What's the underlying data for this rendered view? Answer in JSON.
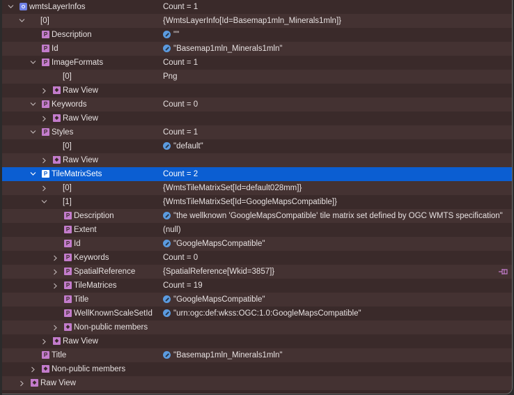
{
  "colors": {
    "selection": "#0b5ed2",
    "property_icon": "#c37ccc",
    "object_icon": "#6f80e6",
    "edit_icon": "#5b9be0"
  },
  "rows": [
    {
      "level": 0,
      "expander": "expanded",
      "icon": "object-icon",
      "name": "wmtsLayerInfos",
      "value": "Count = 1"
    },
    {
      "level": 1,
      "expander": "expanded",
      "icon": "",
      "name": "[0]",
      "value": "{WmtsLayerInfo[Id=Basemap1mln_Minerals1mln]}"
    },
    {
      "level": 2,
      "expander": "",
      "icon": "property-icon",
      "name": "Description",
      "value": "\"\"",
      "editable": true
    },
    {
      "level": 2,
      "expander": "",
      "icon": "property-icon",
      "name": "Id",
      "value": "\"Basemap1mln_Minerals1mln\"",
      "editable": true
    },
    {
      "level": 2,
      "expander": "expanded",
      "icon": "property-icon",
      "name": "ImageFormats",
      "value": "Count = 1"
    },
    {
      "level": 3,
      "expander": "",
      "icon": "",
      "name": "[0]",
      "value": "Png"
    },
    {
      "level": 3,
      "expander": "collapsed",
      "icon": "folder-icon",
      "name": "Raw View",
      "value": ""
    },
    {
      "level": 2,
      "expander": "expanded",
      "icon": "property-icon",
      "name": "Keywords",
      "value": "Count = 0"
    },
    {
      "level": 3,
      "expander": "collapsed",
      "icon": "folder-icon",
      "name": "Raw View",
      "value": ""
    },
    {
      "level": 2,
      "expander": "expanded",
      "icon": "property-icon",
      "name": "Styles",
      "value": "Count = 1"
    },
    {
      "level": 3,
      "expander": "",
      "icon": "",
      "name": "[0]",
      "value": "\"default\"",
      "editable": true
    },
    {
      "level": 3,
      "expander": "collapsed",
      "icon": "folder-icon",
      "name": "Raw View",
      "value": ""
    },
    {
      "level": 2,
      "expander": "expanded",
      "icon": "property-icon",
      "name": "TileMatrixSets",
      "value": "Count = 2",
      "selected": true
    },
    {
      "level": 3,
      "expander": "collapsed",
      "icon": "",
      "name": "[0]",
      "value": "{WmtsTileMatrixSet[Id=default028mm]}"
    },
    {
      "level": 3,
      "expander": "expanded",
      "icon": "",
      "name": "[1]",
      "value": "{WmtsTileMatrixSet[Id=GoogleMapsCompatible]}"
    },
    {
      "level": 4,
      "expander": "",
      "icon": "property-icon",
      "name": "Description",
      "value": "\"the wellknown 'GoogleMapsCompatible' tile matrix set defined by OGC WMTS specification\"",
      "editable": true
    },
    {
      "level": 4,
      "expander": "",
      "icon": "property-icon",
      "name": "Extent",
      "value": "(null)"
    },
    {
      "level": 4,
      "expander": "",
      "icon": "property-icon",
      "name": "Id",
      "value": "\"GoogleMapsCompatible\"",
      "editable": true
    },
    {
      "level": 4,
      "expander": "collapsed",
      "icon": "property-icon",
      "name": "Keywords",
      "value": "Count = 0"
    },
    {
      "level": 4,
      "expander": "collapsed",
      "icon": "property-icon",
      "name": "SpatialReference",
      "value": "{SpatialReference[Wkid=3857]}",
      "pinned": true
    },
    {
      "level": 4,
      "expander": "collapsed",
      "icon": "property-icon",
      "name": "TileMatrices",
      "value": "Count = 19"
    },
    {
      "level": 4,
      "expander": "",
      "icon": "property-icon",
      "name": "Title",
      "value": "\"GoogleMapsCompatible\"",
      "editable": true
    },
    {
      "level": 4,
      "expander": "",
      "icon": "property-icon",
      "name": "WellKnownScaleSetId",
      "value": "\"urn:ogc:def:wkss:OGC:1.0:GoogleMapsCompatible\"",
      "editable": true
    },
    {
      "level": 4,
      "expander": "collapsed",
      "icon": "folder-icon",
      "name": "Non-public members",
      "value": ""
    },
    {
      "level": 3,
      "expander": "collapsed",
      "icon": "folder-icon",
      "name": "Raw View",
      "value": ""
    },
    {
      "level": 2,
      "expander": "",
      "icon": "property-icon",
      "name": "Title",
      "value": "\"Basemap1mln_Minerals1mln\"",
      "editable": true
    },
    {
      "level": 2,
      "expander": "collapsed",
      "icon": "folder-icon",
      "name": "Non-public members",
      "value": ""
    },
    {
      "level": 1,
      "expander": "collapsed",
      "icon": "folder-icon",
      "name": "Raw View",
      "value": ""
    }
  ]
}
